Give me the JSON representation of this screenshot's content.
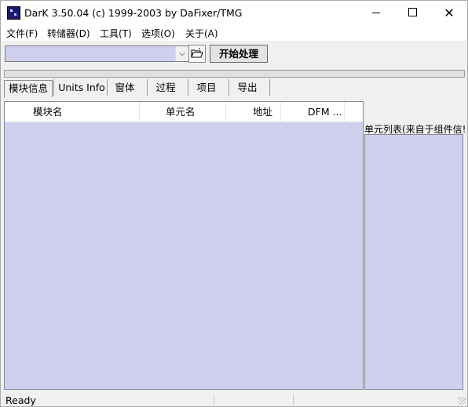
{
  "window": {
    "title": "DarK 3.50.04 (c) 1999-2003 by DaFixer/TMG",
    "controls": {
      "close": "✕"
    }
  },
  "menu": [
    "文件(F)",
    "转储器(D)",
    "工具(T)",
    "选项(O)",
    "关于(A)"
  ],
  "toolbar": {
    "combo_value": "",
    "open_icon": "folder-open-icon",
    "start_label": "开始处理"
  },
  "progress": {
    "fraction": 0
  },
  "tabs": [
    "模块信息",
    "Units Info",
    "窗体",
    "过程",
    "项目",
    "导出"
  ],
  "active_tab": "模块信息",
  "list": {
    "columns": [
      "模块名",
      "单元名",
      "地址",
      "DFM ..."
    ],
    "rows": []
  },
  "side_panel": {
    "label": "单元列表(来自于组件信!",
    "items": []
  },
  "status": {
    "text": "Ready"
  },
  "colors": {
    "list_background": "#cfcfee",
    "window_background": "#f0f0f0"
  }
}
